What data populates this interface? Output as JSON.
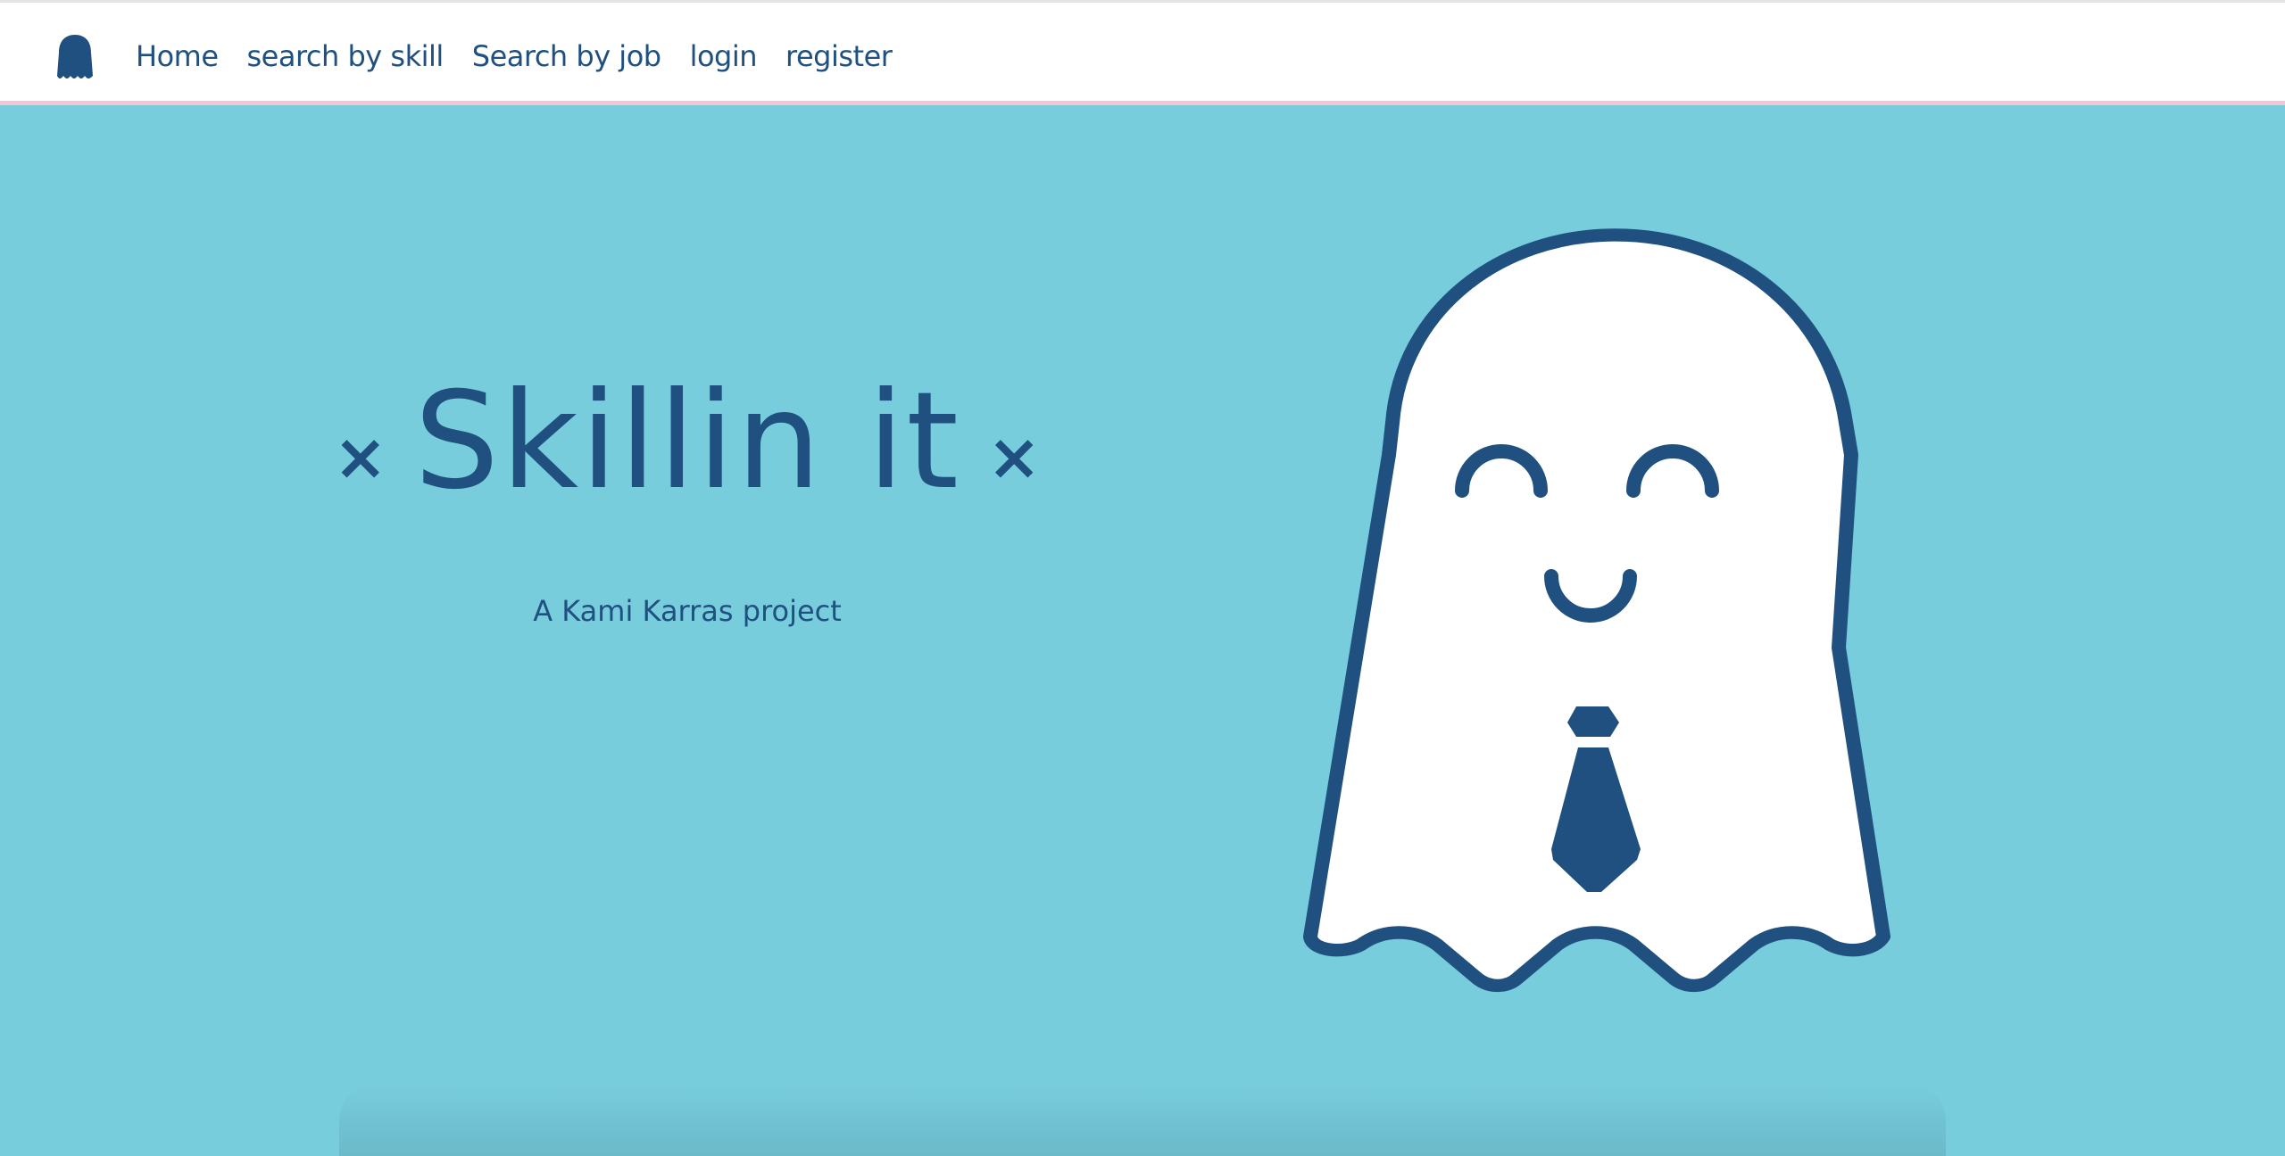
{
  "nav": {
    "logo_icon": "ghost-icon",
    "links": [
      {
        "label": "Home"
      },
      {
        "label": "search by skill"
      },
      {
        "label": "Search by job"
      },
      {
        "label": "login"
      },
      {
        "label": "register"
      }
    ]
  },
  "hero": {
    "title": "Skillin it",
    "sparkle_left": "×",
    "sparkle_right": "×",
    "subtitle": "A Kami Karras project",
    "illustration_icon": "ghost-with-tie-icon"
  },
  "colors": {
    "background": "#78cddd",
    "primary": "#20507f",
    "nav_bg": "#ffffff",
    "nav_border": "#f2c6d3"
  }
}
